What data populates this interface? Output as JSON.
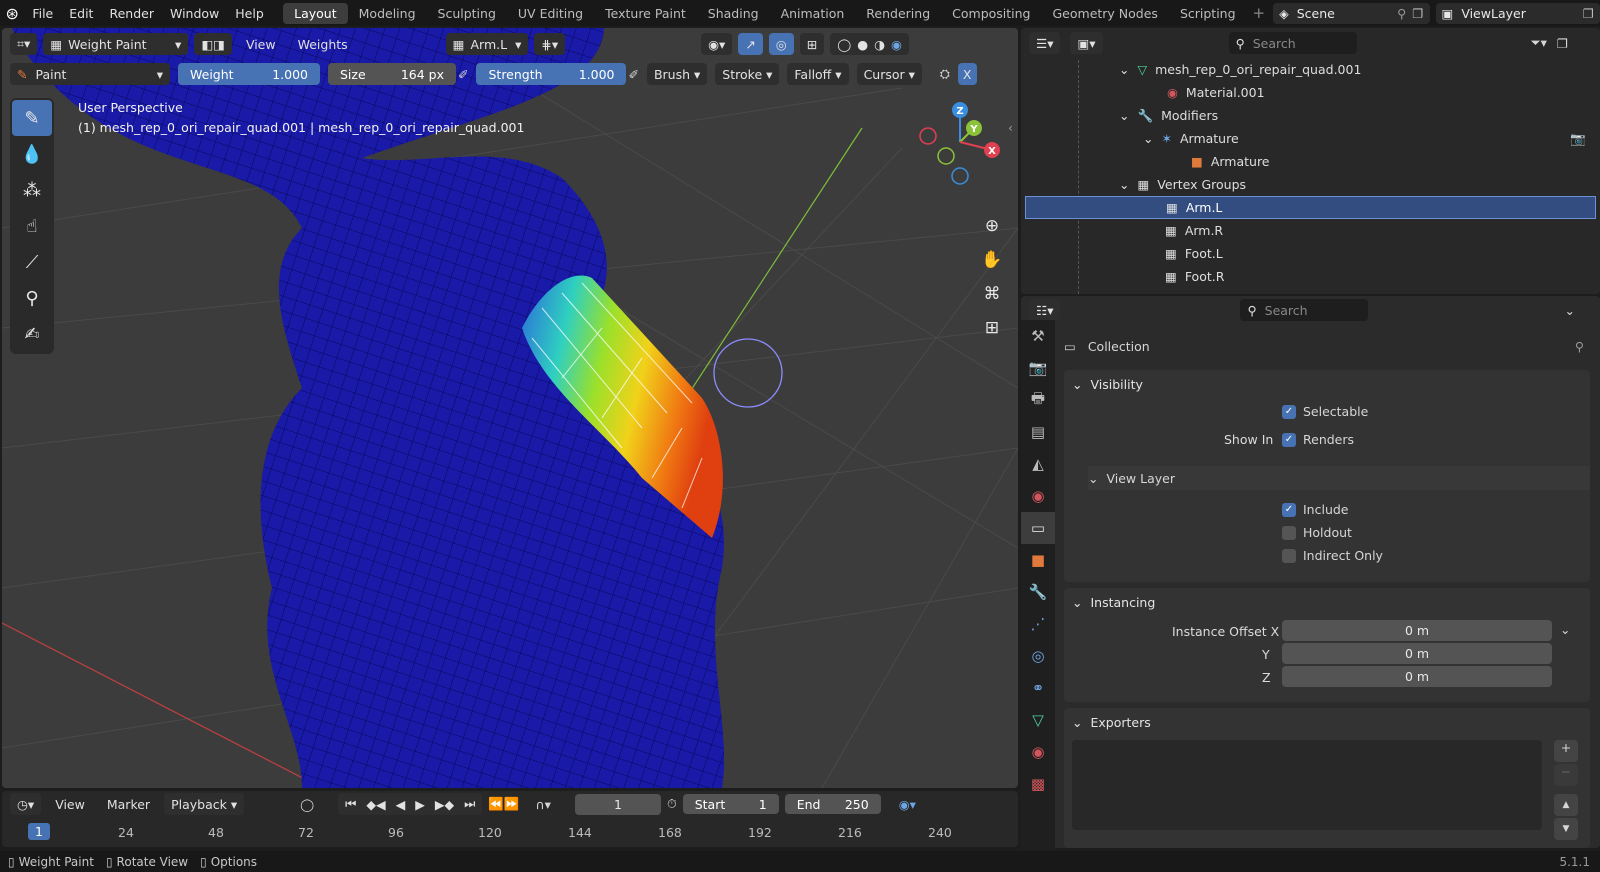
{
  "app": {
    "logo_icon": "blender-logo-icon",
    "version": "5.1.1"
  },
  "menus": [
    "File",
    "Edit",
    "Render",
    "Window",
    "Help"
  ],
  "workspaces": [
    "Layout",
    "Modeling",
    "Sculpting",
    "UV Editing",
    "Texture Paint",
    "Shading",
    "Animation",
    "Rendering",
    "Compositing",
    "Geometry Nodes",
    "Scripting"
  ],
  "active_workspace": "Layout",
  "scene": {
    "name": "Scene"
  },
  "view_layer": {
    "name": "ViewLayer"
  },
  "viewport": {
    "mode": "Weight Paint",
    "menus": [
      "View",
      "Weights"
    ],
    "vertex_group": "Arm.L",
    "brush": "Paint",
    "weight_label": "Weight",
    "weight_value": "1.000",
    "size_label": "Size",
    "size_value": "164 px",
    "strength_label": "Strength",
    "strength_value": "1.000",
    "dropdowns": [
      "Brush",
      "Stroke",
      "Falloff",
      "Cursor"
    ],
    "close_label": "X",
    "overlay_line1": "User Perspective",
    "overlay_line2": "(1) mesh_rep_0_ori_repair_quad.001 | mesh_rep_0_ori_repair_quad.001",
    "gizmo_axes": {
      "z": "Z",
      "y": "Y",
      "x": "X"
    },
    "mesh_color": "#1a1aa8"
  },
  "outliner": {
    "search_placeholder": "Search",
    "rows": [
      {
        "label": "mesh_rep_0_ori_repair_quad.001",
        "icon": "mesh-data-icon",
        "color": "#4fd39b"
      },
      {
        "label": "Material.001",
        "icon": "material-icon",
        "color": "#d2575c"
      },
      {
        "label": "Modifiers",
        "icon": "wrench-icon",
        "color": "#6ea5e4"
      },
      {
        "label": "Armature",
        "icon": "armature-modifier-icon",
        "color": "#6ea5e4"
      },
      {
        "label": "Armature",
        "icon": "armature-object-icon",
        "color": "#e07a3c"
      },
      {
        "label": "Vertex Groups",
        "icon": "vertex-groups-icon",
        "color": "#bfbfbf"
      },
      {
        "label": "Arm.L",
        "icon": "vertex-group-icon",
        "color": "#bfbfbf",
        "selected": true
      },
      {
        "label": "Arm.R",
        "icon": "vertex-group-icon",
        "color": "#bfbfbf"
      },
      {
        "label": "Foot.L",
        "icon": "vertex-group-icon",
        "color": "#bfbfbf"
      },
      {
        "label": "Foot.R",
        "icon": "vertex-group-icon",
        "color": "#bfbfbf"
      }
    ]
  },
  "properties": {
    "search_placeholder": "Search",
    "context": "Collection",
    "visibility": {
      "title": "Visibility",
      "selectable": "Selectable",
      "show_in": "Show In",
      "renders": "Renders"
    },
    "view_layer": {
      "title": "View Layer",
      "include": "Include",
      "holdout": "Holdout",
      "indirect_only": "Indirect Only"
    },
    "instancing": {
      "title": "Instancing",
      "offset_x_label": "Instance Offset X",
      "y_label": "Y",
      "z_label": "Z",
      "x": "0 m",
      "y": "0 m",
      "z": "0 m"
    },
    "exporters": {
      "title": "Exporters"
    },
    "tab_icons": [
      "tool-icon",
      "render-icon",
      "output-icon",
      "view-layer-icon",
      "scene-icon",
      "world-icon",
      "collection-icon",
      "object-icon",
      "modifier-icon",
      "particles-icon",
      "physics-icon",
      "constraints-icon",
      "data-icon",
      "material-icon",
      "texture-icon"
    ]
  },
  "timeline": {
    "menus": [
      "View",
      "Marker",
      "Playback"
    ],
    "current_frame": "1",
    "start_label": "Start",
    "start": "1",
    "end_label": "End",
    "end": "250",
    "ruler": [
      "1",
      "24",
      "48",
      "72",
      "96",
      "120",
      "144",
      "168",
      "192",
      "216",
      "240"
    ]
  },
  "statusbar": [
    "Weight Paint",
    "Rotate View",
    "Options"
  ],
  "colors": {
    "accent": "#4772b3",
    "selection": "#334d80",
    "bg": "#1d1d1d"
  }
}
